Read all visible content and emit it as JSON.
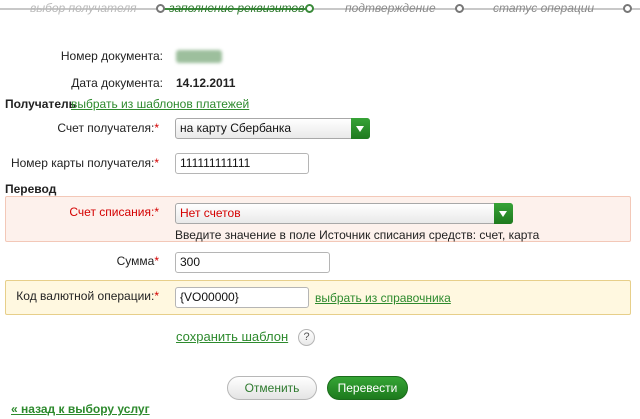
{
  "steps": [
    {
      "label": "выбор получателя"
    },
    {
      "label": "заполнение реквизитов"
    },
    {
      "label": "подтверждение"
    },
    {
      "label": "статус операции"
    }
  ],
  "document": {
    "number_label": "Номер документа:",
    "date_label": "Дата документа:",
    "date_value": "14.12.2011"
  },
  "recipient": {
    "section_label": "Получатель",
    "templates_link": "выбрать из шаблонов платежей",
    "account_label": "Счет получателя:",
    "account_value": "на карту Сбербанка",
    "card_label": "Номер карты получателя:",
    "card_value": "111111111111"
  },
  "transfer": {
    "section_label": "Перевод",
    "debit_label": "Счет списания:",
    "debit_value": "Нет счетов",
    "debit_hint": "Введите значение в поле Источник списания средств: счет, карта",
    "amount_label": "Сумма",
    "amount_value": "300",
    "currency_op_label": "Код валютной операции:",
    "currency_op_value": "{VO00000}",
    "directory_link": "выбрать из справочника"
  },
  "required_mark": "*",
  "save_template_link": "сохранить шаблон",
  "help_glyph": "?",
  "buttons": {
    "cancel": "Отменить",
    "submit": "Перевести"
  },
  "back_link": "« назад к выбору услуг",
  "colors": {
    "accent_green": "#2d8a2d",
    "error_red": "#d40000"
  }
}
